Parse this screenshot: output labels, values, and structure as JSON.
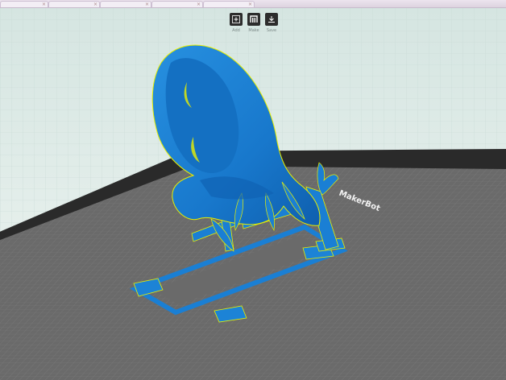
{
  "browser": {
    "tabs": [
      {
        "label": ""
      },
      {
        "label": ""
      },
      {
        "label": ""
      },
      {
        "label": ""
      },
      {
        "label": ""
      }
    ]
  },
  "toolbar": {
    "buttons": [
      {
        "icon": "add-icon",
        "label": "Add"
      },
      {
        "icon": "makerbot-logo-icon",
        "label": "Make"
      },
      {
        "icon": "save-icon",
        "label": "Save"
      }
    ]
  },
  "build_plate": {
    "brand_text": "MakerBot"
  },
  "colors": {
    "viewport_bg_top": "#d9e7e4",
    "viewport_bg_bottom": "#eef4f1",
    "plate_gray": "#6f6f6f",
    "plate_border": "#2b2b2b",
    "model_blue": "#1a7fd4",
    "model_outline": "#e8f000",
    "toolbar_button": "#2c2c2c"
  }
}
